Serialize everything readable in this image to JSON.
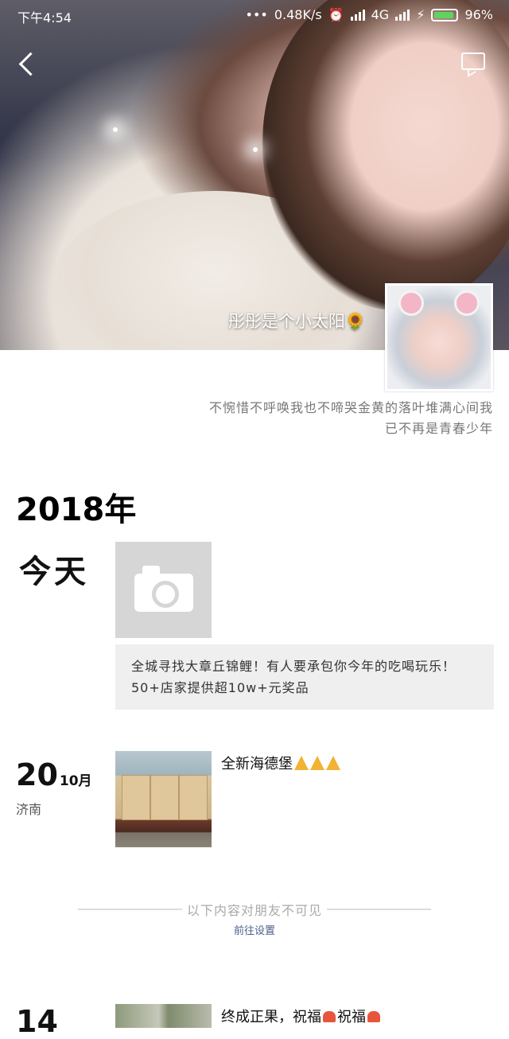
{
  "status_bar": {
    "time": "下午4:54",
    "network_speed": "0.48K/s",
    "network_type": "4G",
    "battery": "96%"
  },
  "header": {
    "nickname": "彤彤是个小太阳🌻",
    "signature_line1": "不惋惜不呼唤我也不啼哭金黄的落叶堆满心间我",
    "signature_line2": "已不再是青春少年"
  },
  "timeline": {
    "year": "2018年",
    "today_label": "今天",
    "promo_text": "全城寻找大章丘锦鲤！有人要承包你今年的吃喝玩乐！50+店家提供超10w+元奖品",
    "post1": {
      "day": "20",
      "month": "10月",
      "location": "济南",
      "text": "全新海德堡"
    },
    "hidden_note": "以下内容对朋友不可见",
    "goto_settings": "前往设置",
    "post2": {
      "day": "14",
      "text": "终成正果，祝福",
      "text2": "祝福"
    }
  },
  "colors": {
    "accent_link": "#4a5f8a",
    "promo_bg": "#efefef",
    "placeholder_bg": "#d6d6d6"
  }
}
